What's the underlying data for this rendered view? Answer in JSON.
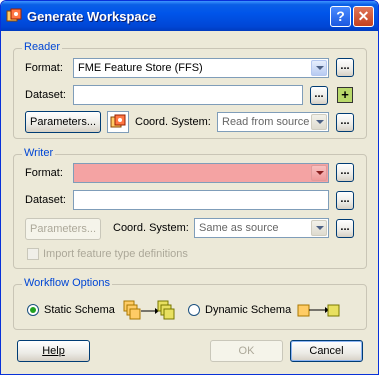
{
  "window": {
    "title": "Generate Workspace",
    "help_btn": "?",
    "close_btn": "✕"
  },
  "reader": {
    "legend": "Reader",
    "format_label": "Format:",
    "format_value": "FME Feature Store (FFS)",
    "dataset_label": "Dataset:",
    "dataset_value": "",
    "parameters_label": "Parameters...",
    "coord_label": "Coord. System:",
    "coord_value": "Read from source",
    "ellipsis": "...",
    "add_label": "+"
  },
  "writer": {
    "legend": "Writer",
    "format_label": "Format:",
    "format_value": "",
    "dataset_label": "Dataset:",
    "dataset_value": "",
    "parameters_label": "Parameters...",
    "coord_label": "Coord. System:",
    "coord_value": "Same as source",
    "ellipsis": "...",
    "import_label": "Import feature type definitions"
  },
  "workflow": {
    "legend": "Workflow Options",
    "static_label": "Static Schema",
    "dynamic_label": "Dynamic Schema",
    "selected": "static"
  },
  "buttons": {
    "help": "Help",
    "ok": "OK",
    "cancel": "Cancel"
  },
  "colors": {
    "title_blue": "#0055ea",
    "group_legend": "#0046d5",
    "invalid_field": "#f4a3a3",
    "radio_dot": "#21a121"
  }
}
